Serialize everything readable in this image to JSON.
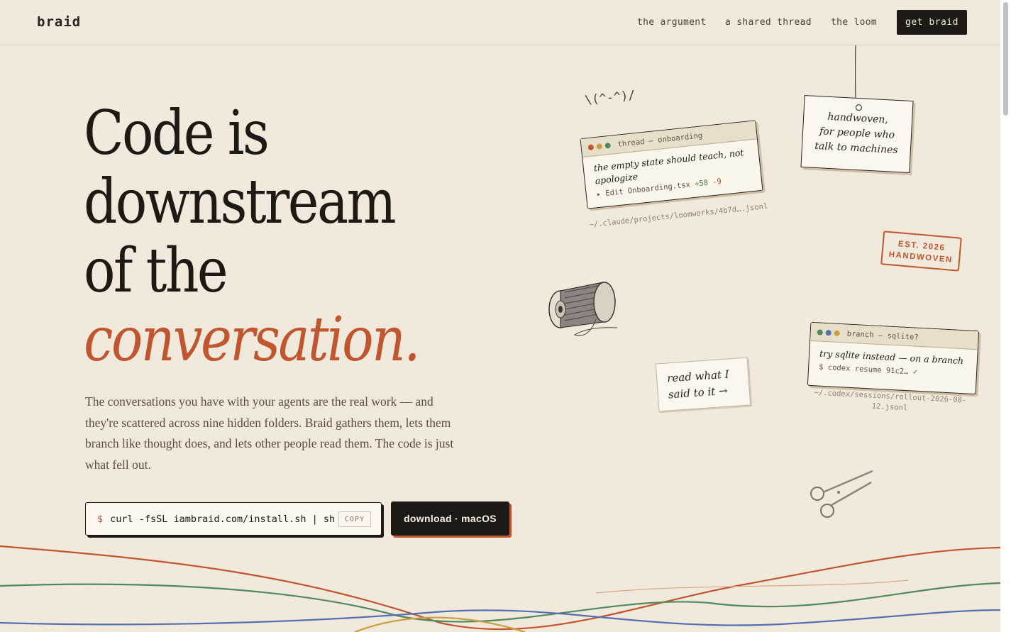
{
  "header": {
    "logo": "braid",
    "nav": [
      {
        "label": "the argument"
      },
      {
        "label": "a shared thread"
      },
      {
        "label": "the loom"
      }
    ],
    "cta_label": "get braid"
  },
  "hero": {
    "headline_lines": [
      "Code is",
      "downstream",
      "of the"
    ],
    "headline_accent": "conversation.",
    "lede": "The conversations you have with your agents are the real work — and they're scattered across nine hidden folders. Braid gathers them, lets them branch like thought does, and lets other people read them. The code is just what fell out.",
    "install": {
      "prompt": "$",
      "command": "curl -fsSL iambraid.com/install.sh | sh",
      "copy_label": "COPY"
    },
    "download_label": "download · macOS"
  },
  "decor": {
    "kaomoji": "\\(^-^)/",
    "thread_card": {
      "title": "thread — onboarding",
      "text": "the empty state should teach, not apologize",
      "meta_prefix": "▸ Edit Onboarding.tsx",
      "plus": "+58",
      "minus": "-9",
      "path": "~/.claude/projects/loomworks/4b7d….jsonl"
    },
    "tag_lines": [
      "handwoven,",
      "for people who",
      "talk to machines"
    ],
    "stamp_lines": [
      "EST. 2026",
      "HANDWOVEN"
    ],
    "note_lines": [
      "read what I",
      "said to it →"
    ],
    "branch_card": {
      "title": "branch — sqlite?",
      "text": "try sqlite instead — on a branch",
      "meta": "$ codex resume 91c2… ✓",
      "path_lines": [
        "~/.codex/sessions/rollout-2026-08-",
        "12.jsonl"
      ]
    },
    "colors": {
      "accent": "#c0562f",
      "ink": "#1d1915",
      "paper": "#f1e9db",
      "thread_green": "#4f8a5e",
      "thread_blue": "#5470b0",
      "thread_gold": "#c9a040"
    }
  }
}
